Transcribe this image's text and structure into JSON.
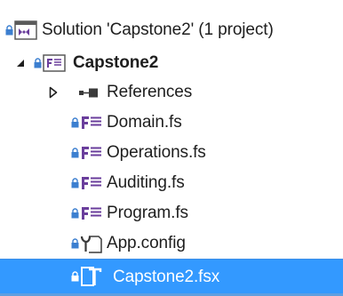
{
  "solution_explorer": {
    "solution": {
      "label": "Solution 'Capstone2' (1 project)",
      "icon": "solution-icon"
    },
    "project": {
      "label": "Capstone2",
      "icon": "fsharp-project-icon",
      "expanded": true
    },
    "references": {
      "label": "References",
      "icon": "references-icon",
      "expanded": false
    },
    "files": [
      {
        "label": "Domain.fs",
        "icon": "fsharp-file-icon"
      },
      {
        "label": "Operations.fs",
        "icon": "fsharp-file-icon"
      },
      {
        "label": "Auditing.fs",
        "icon": "fsharp-file-icon"
      },
      {
        "label": "Program.fs",
        "icon": "fsharp-file-icon"
      },
      {
        "label": "App.config",
        "icon": "config-file-icon"
      },
      {
        "label": "Capstone2.fsx",
        "icon": "fsharp-script-icon",
        "selected": true
      }
    ],
    "colors": {
      "selection": "#3399ff",
      "fsharp_icon": "#6a3e9c",
      "lock": "#3c7fd0",
      "text": "#1e1e1e"
    }
  }
}
